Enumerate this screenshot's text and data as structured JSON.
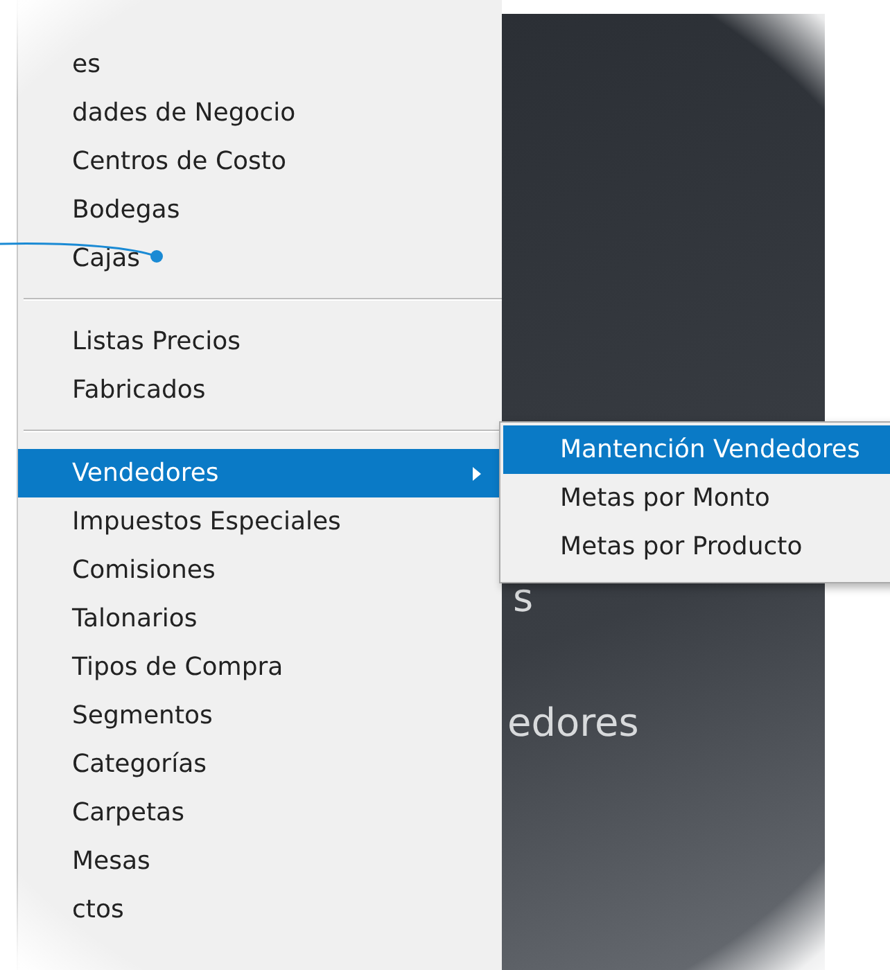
{
  "menu": {
    "items": [
      {
        "kind": "item",
        "label": "es",
        "selected": false
      },
      {
        "kind": "item",
        "label": "dades de Negocio",
        "selected": false
      },
      {
        "kind": "item",
        "label": "Centros de Costo",
        "selected": false
      },
      {
        "kind": "item",
        "label": "Bodegas",
        "selected": false
      },
      {
        "kind": "item",
        "label": "Cajas",
        "selected": false
      },
      {
        "kind": "separator"
      },
      {
        "kind": "item",
        "label": "Listas Precios",
        "selected": false
      },
      {
        "kind": "item",
        "label": "Fabricados",
        "selected": false
      },
      {
        "kind": "separator"
      },
      {
        "kind": "submenu_item",
        "label": "Vendedores",
        "selected": true
      },
      {
        "kind": "item",
        "label": "Impuestos Especiales",
        "selected": false
      },
      {
        "kind": "item",
        "label": "Comisiones",
        "selected": false
      },
      {
        "kind": "item",
        "label": "Talonarios",
        "selected": false
      },
      {
        "kind": "item",
        "label": "Tipos de Compra",
        "selected": false
      },
      {
        "kind": "item",
        "label": "Segmentos",
        "selected": false
      },
      {
        "kind": "item",
        "label": "Categorías",
        "selected": false
      },
      {
        "kind": "item",
        "label": "Carpetas",
        "selected": false
      },
      {
        "kind": "item",
        "label": "Mesas",
        "selected": false
      },
      {
        "kind": "item",
        "label": "ctos",
        "selected": false
      }
    ]
  },
  "submenu": {
    "items": [
      {
        "label": "Mantención Vendedores",
        "selected": true
      },
      {
        "label": "Metas por Monto",
        "selected": false
      },
      {
        "label": "Metas por Producto",
        "selected": false
      }
    ]
  },
  "background_panel": {
    "texts": [
      "s",
      "edores"
    ]
  }
}
